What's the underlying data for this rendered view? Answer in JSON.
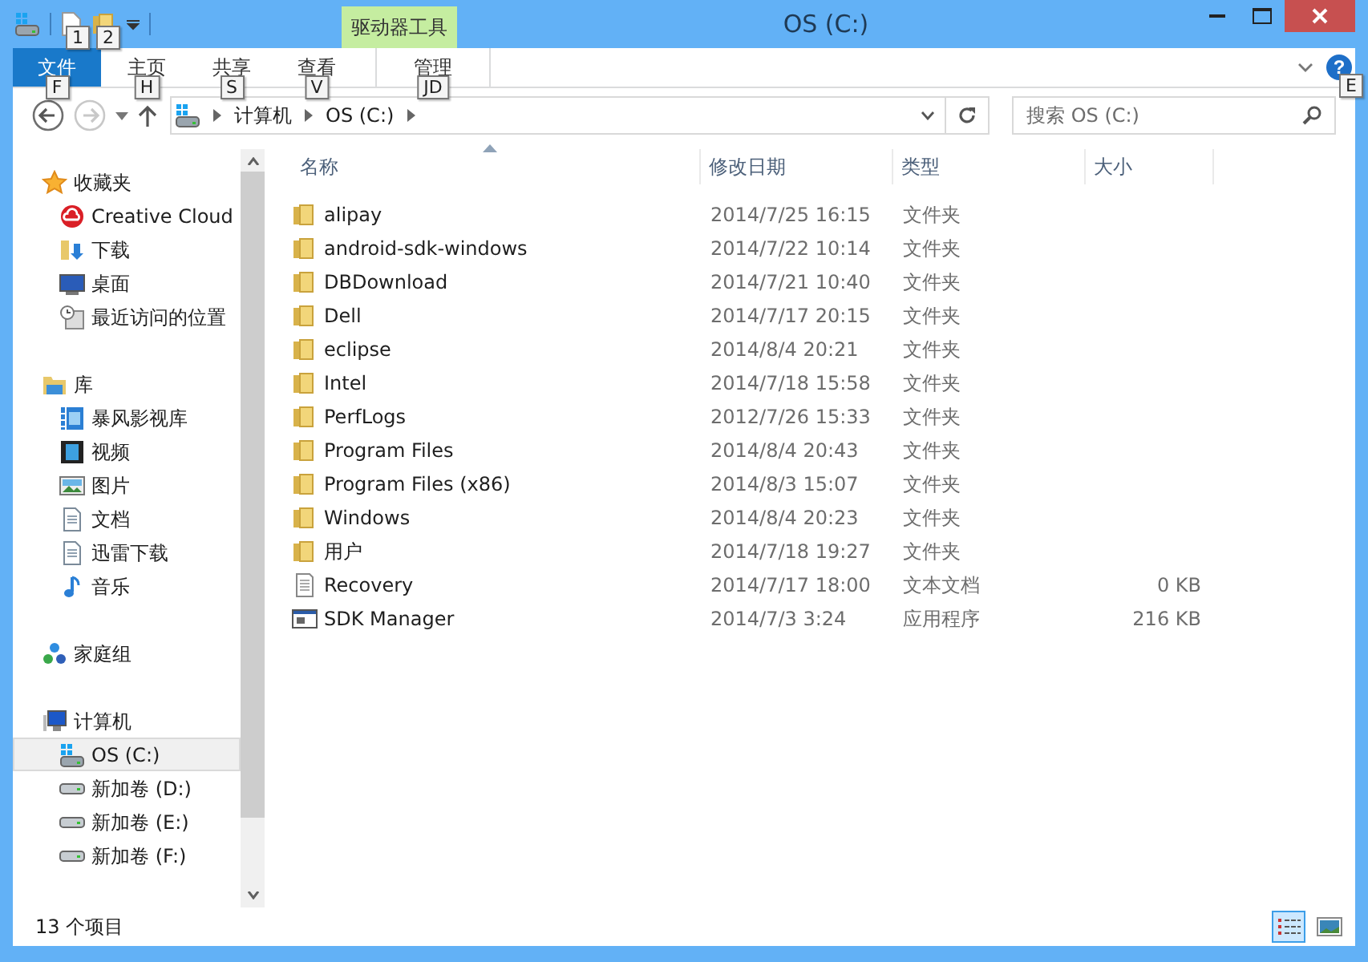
{
  "window": {
    "title": "OS (C:)",
    "contextual_tab": "驱动器工具"
  },
  "quick_access": [
    {
      "kind": "document",
      "keytip": "1"
    },
    {
      "kind": "folder",
      "keytip": "2"
    }
  ],
  "ribbon_tabs": [
    {
      "label": "文件",
      "keytip": "F",
      "kind": "file",
      "selected": false
    },
    {
      "label": "主页",
      "keytip": "H",
      "kind": "tab",
      "selected": false
    },
    {
      "label": "共享",
      "keytip": "S",
      "kind": "tab",
      "selected": false
    },
    {
      "label": "查看",
      "keytip": "V",
      "kind": "tab",
      "selected": false
    },
    {
      "label": "管理",
      "keytip": "JD",
      "kind": "contextual",
      "selected": false
    }
  ],
  "help": {
    "glyph": "?",
    "keytip": "E"
  },
  "address": {
    "forward_disabled": true,
    "crumbs": [
      "计算机",
      "OS (C:)"
    ]
  },
  "search": {
    "placeholder": "搜索 OS (C:)"
  },
  "sidebar": [
    {
      "label": "收藏夹",
      "kind": "star",
      "selected": false,
      "children": [
        {
          "label": "Creative Cloud",
          "kind": "cloud",
          "selected": false
        },
        {
          "label": "下载",
          "kind": "download",
          "selected": false
        },
        {
          "label": "桌面",
          "kind": "desktop",
          "selected": false
        },
        {
          "label": "最近访问的位置",
          "kind": "recent",
          "selected": false
        }
      ]
    },
    {
      "label": "库",
      "kind": "library",
      "selected": false,
      "children": [
        {
          "label": "暴风影视库",
          "kind": "filmlib",
          "selected": false
        },
        {
          "label": "视频",
          "kind": "video",
          "selected": false
        },
        {
          "label": "图片",
          "kind": "picture",
          "selected": false
        },
        {
          "label": "文档",
          "kind": "doc",
          "selected": false
        },
        {
          "label": "迅雷下载",
          "kind": "doc",
          "selected": false
        },
        {
          "label": "音乐",
          "kind": "music",
          "selected": false
        }
      ]
    },
    {
      "label": "家庭组",
      "kind": "homegroup",
      "selected": false
    },
    {
      "label": "计算机",
      "kind": "computer",
      "selected": false,
      "children": [
        {
          "label": "OS (C:)",
          "kind": "osdrive",
          "selected": true
        },
        {
          "label": "新加卷 (D:)",
          "kind": "drive",
          "selected": false
        },
        {
          "label": "新加卷 (E:)",
          "kind": "drive",
          "selected": false
        },
        {
          "label": "新加卷 (F:)",
          "kind": "drive",
          "selected": false
        }
      ]
    }
  ],
  "table": {
    "columns": [
      {
        "label": "名称",
        "sorted": true
      },
      {
        "label": "修改日期",
        "sorted": false
      },
      {
        "label": "类型",
        "sorted": false
      },
      {
        "label": "大小",
        "sorted": false
      }
    ],
    "rows": [
      {
        "kind": "folder",
        "name": "alipay",
        "date": "2014/7/25 16:15",
        "type": "文件夹",
        "selected": false
      },
      {
        "kind": "folder",
        "name": "android-sdk-windows",
        "date": "2014/7/22 10:14",
        "type": "文件夹",
        "selected": false
      },
      {
        "kind": "folder",
        "name": "DBDownload",
        "date": "2014/7/21 10:40",
        "type": "文件夹",
        "selected": false
      },
      {
        "kind": "folder",
        "name": "Dell",
        "date": "2014/7/17 20:15",
        "type": "文件夹",
        "selected": false
      },
      {
        "kind": "folder",
        "name": "eclipse",
        "date": "2014/8/4 20:21",
        "type": "文件夹",
        "selected": false
      },
      {
        "kind": "folder",
        "name": "Intel",
        "date": "2014/7/18 15:58",
        "type": "文件夹",
        "selected": false
      },
      {
        "kind": "folder",
        "name": "PerfLogs",
        "date": "2012/7/26 15:33",
        "type": "文件夹",
        "selected": false
      },
      {
        "kind": "folder",
        "name": "Program Files",
        "date": "2014/8/4 20:43",
        "type": "文件夹",
        "selected": false
      },
      {
        "kind": "folder",
        "name": "Program Files (x86)",
        "date": "2014/8/3 15:07",
        "type": "文件夹",
        "selected": false
      },
      {
        "kind": "folder",
        "name": "Windows",
        "date": "2014/8/4 20:23",
        "type": "文件夹",
        "selected": false
      },
      {
        "kind": "folder",
        "name": "用户",
        "date": "2014/7/18 19:27",
        "type": "文件夹",
        "selected": false
      },
      {
        "kind": "text",
        "name": "Recovery",
        "date": "2014/7/17 18:00",
        "type": "文本文档",
        "size": "0 KB",
        "selected": false
      },
      {
        "kind": "app",
        "name": "SDK Manager",
        "date": "2014/7/3 3:24",
        "type": "应用程序",
        "size": "216 KB",
        "selected": false
      }
    ]
  },
  "status_bar": {
    "count": "13 个项目",
    "views": [
      {
        "kind": "details",
        "selected": true
      },
      {
        "kind": "thumbnails",
        "selected": false
      }
    ]
  }
}
